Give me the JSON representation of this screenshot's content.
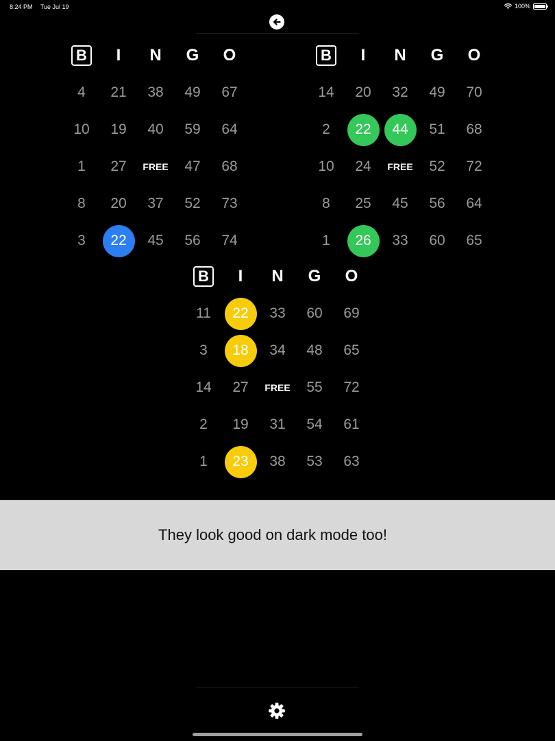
{
  "status_bar": {
    "time": "8:24 PM",
    "date": "Tue Jul 19",
    "battery": "100%"
  },
  "colors": {
    "blue": "#2b7ff0",
    "green": "#34c759",
    "yellow": "#f7cc0c",
    "number_gray": "#9a9a9a"
  },
  "icons": {
    "back": "arrow-left-circle-icon",
    "settings": "gear-icon",
    "wifi": "wifi-icon",
    "battery": "battery-icon"
  },
  "cards": [
    {
      "headers": [
        "B",
        "I",
        "N",
        "G",
        "O"
      ],
      "rows": [
        [
          "4",
          "21",
          "38",
          "49",
          "67"
        ],
        [
          "10",
          "19",
          "40",
          "59",
          "64"
        ],
        [
          "1",
          "27",
          "FREE",
          "47",
          "68"
        ],
        [
          "8",
          "20",
          "37",
          "52",
          "73"
        ],
        [
          "3",
          "22",
          "45",
          "56",
          "74"
        ]
      ],
      "marked": [
        {
          "row": 4,
          "col": 1,
          "color": "blue"
        }
      ]
    },
    {
      "headers": [
        "B",
        "I",
        "N",
        "G",
        "O"
      ],
      "rows": [
        [
          "14",
          "20",
          "32",
          "49",
          "70"
        ],
        [
          "2",
          "22",
          "44",
          "51",
          "68"
        ],
        [
          "10",
          "24",
          "FREE",
          "52",
          "72"
        ],
        [
          "8",
          "25",
          "45",
          "56",
          "64"
        ],
        [
          "1",
          "26",
          "33",
          "60",
          "65"
        ]
      ],
      "marked": [
        {
          "row": 1,
          "col": 1,
          "color": "green"
        },
        {
          "row": 1,
          "col": 2,
          "color": "green"
        },
        {
          "row": 4,
          "col": 1,
          "color": "green"
        }
      ]
    },
    {
      "headers": [
        "B",
        "I",
        "N",
        "G",
        "O"
      ],
      "rows": [
        [
          "11",
          "22",
          "33",
          "60",
          "69"
        ],
        [
          "3",
          "18",
          "34",
          "48",
          "65"
        ],
        [
          "14",
          "27",
          "FREE",
          "55",
          "72"
        ],
        [
          "2",
          "19",
          "31",
          "54",
          "61"
        ],
        [
          "1",
          "23",
          "38",
          "53",
          "63"
        ]
      ],
      "marked": [
        {
          "row": 0,
          "col": 1,
          "color": "yellow"
        },
        {
          "row": 1,
          "col": 1,
          "color": "yellow"
        },
        {
          "row": 4,
          "col": 1,
          "color": "yellow"
        }
      ]
    }
  ],
  "caption": "They look good on dark mode too!"
}
